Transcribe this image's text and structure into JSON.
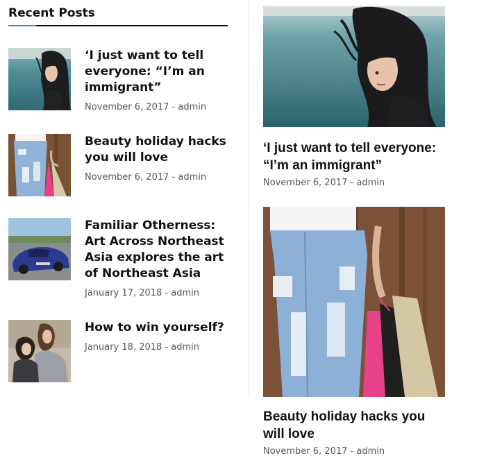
{
  "widget": {
    "title": "Recent Posts"
  },
  "recent_posts": [
    {
      "title": "‘I just want to tell everyone: “I’m an immigrant”",
      "date": "November 6, 2017",
      "separator": "-",
      "author": "admin",
      "thumb": "woman-windblown-hair-photo"
    },
    {
      "title": "Beauty holiday hacks you will love",
      "date": "November 6, 2017",
      "separator": "-",
      "author": "admin",
      "thumb": "ripped-jeans-shopping-bags-photo"
    },
    {
      "title": "Familiar Otherness: Art Across Northeast Asia explores the art of Northeast Asia",
      "date": "January 17, 2018",
      "separator": "-",
      "author": "admin",
      "thumb": "blue-sports-car-photo"
    },
    {
      "title": "How to win yourself?",
      "date": "January 18, 2018",
      "separator": "-",
      "author": "admin",
      "thumb": "two-women-outdoors-photo"
    }
  ],
  "featured_posts": [
    {
      "title": "‘I just want to tell everyone: “I’m an immigrant”",
      "date": "November 6, 2017",
      "separator": "-",
      "author": "admin",
      "image": "woman-windblown-hair-photo"
    },
    {
      "title": "Beauty holiday hacks you will love",
      "date": "November 6, 2017",
      "separator": "-",
      "author": "admin",
      "image": "ripped-jeans-shopping-bags-photo"
    }
  ],
  "colors": {
    "accent": "#2b8fd6",
    "text": "#111111",
    "meta": "#555555"
  }
}
